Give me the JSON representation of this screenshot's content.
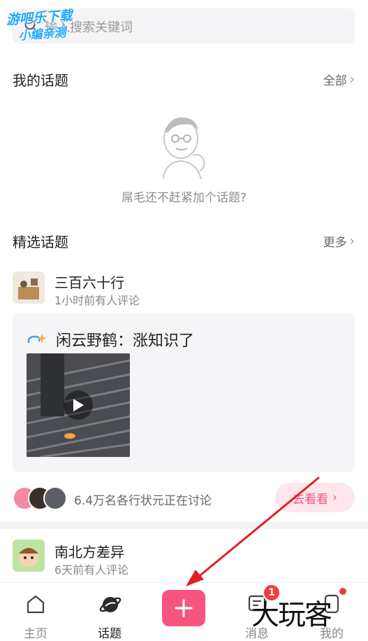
{
  "watermark_top": [
    "游吧乐下载",
    "小编亲测"
  ],
  "search": {
    "placeholder": "输入搜索关键词"
  },
  "my_topics": {
    "title": "我的话题",
    "link": "全部",
    "empty_text": "屌毛还不赶紧加个话题?"
  },
  "featured": {
    "title": "精选话题",
    "link": "更多",
    "topics": [
      {
        "name": "三百六十行",
        "meta": "1小时前有人评论"
      },
      {
        "name": "南北方差异",
        "meta": "6天前有人评论"
      }
    ]
  },
  "post": {
    "title": "闲云野鹤：涨知识了",
    "video_icon": "play-icon"
  },
  "discussion": {
    "text": "6.4万名各行状元正在讨论",
    "button": "去看看"
  },
  "tabbar": {
    "tabs": [
      {
        "label": "主页",
        "icon": "home-icon"
      },
      {
        "label": "话题",
        "icon": "planet-icon"
      },
      {
        "label": "",
        "icon": "plus-icon"
      },
      {
        "label": "消息",
        "icon": "message-icon"
      },
      {
        "label": "我的",
        "icon": "profile-icon"
      }
    ],
    "message_badge": "1",
    "active_tab": "话题"
  },
  "watermark_bottom": "大玩客",
  "colors": {
    "accent": "#f6557e",
    "badge": "#f23b3b",
    "annotation_arrow": "#e02020",
    "watermark": "#1ea7ff"
  }
}
